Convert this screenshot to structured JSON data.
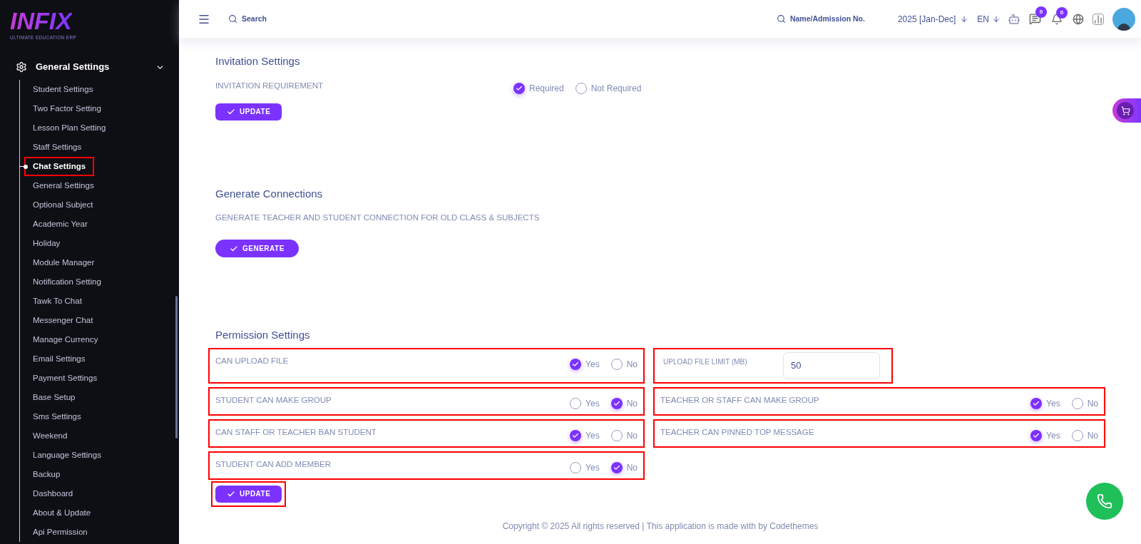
{
  "brand": {
    "logo": "INFIX",
    "tagline": "ULTIMATE EDUCATION ERP"
  },
  "sidebar": {
    "group": {
      "label": "General Settings",
      "expanded": true,
      "items": [
        {
          "label": "Student Settings",
          "selected": false,
          "highlighted": false
        },
        {
          "label": "Two Factor Setting",
          "selected": false,
          "highlighted": false
        },
        {
          "label": "Lesson Plan Setting",
          "selected": false,
          "highlighted": false
        },
        {
          "label": "Staff Settings",
          "selected": false,
          "highlighted": false
        },
        {
          "label": "Chat Settings",
          "selected": true,
          "highlighted": true
        },
        {
          "label": "General Settings",
          "selected": false,
          "highlighted": false
        },
        {
          "label": "Optional Subject",
          "selected": false,
          "highlighted": false
        },
        {
          "label": "Academic Year",
          "selected": false,
          "highlighted": false
        },
        {
          "label": "Holiday",
          "selected": false,
          "highlighted": false
        },
        {
          "label": "Module Manager",
          "selected": false,
          "highlighted": false
        },
        {
          "label": "Notification Setting",
          "selected": false,
          "highlighted": false
        },
        {
          "label": "Tawk To Chat",
          "selected": false,
          "highlighted": false
        },
        {
          "label": "Messenger Chat",
          "selected": false,
          "highlighted": false
        },
        {
          "label": "Manage Currency",
          "selected": false,
          "highlighted": false
        },
        {
          "label": "Email Settings",
          "selected": false,
          "highlighted": false
        },
        {
          "label": "Payment Settings",
          "selected": false,
          "highlighted": false
        },
        {
          "label": "Base Setup",
          "selected": false,
          "highlighted": false
        },
        {
          "label": "Sms Settings",
          "selected": false,
          "highlighted": false
        },
        {
          "label": "Weekend",
          "selected": false,
          "highlighted": false
        },
        {
          "label": "Language Settings",
          "selected": false,
          "highlighted": false
        },
        {
          "label": "Backup",
          "selected": false,
          "highlighted": false
        },
        {
          "label": "Dashboard",
          "selected": false,
          "highlighted": false
        },
        {
          "label": "About & Update",
          "selected": false,
          "highlighted": false
        },
        {
          "label": "Api Permission",
          "selected": false,
          "highlighted": false
        }
      ]
    }
  },
  "header": {
    "search_placeholder": "Search",
    "student_search_placeholder": "Name/Admission No.",
    "year": "2025 [Jan-Dec]",
    "language": "EN",
    "messages_badge": "0",
    "notifications_badge": "0"
  },
  "invitation": {
    "title": "Invitation Settings",
    "label": "INVITATION REQUIREMENT",
    "options": [
      {
        "label": "Required",
        "selected": true
      },
      {
        "label": "Not Required",
        "selected": false
      }
    ],
    "button": "UPDATE"
  },
  "connections": {
    "title": "Generate Connections",
    "description": "GENERATE TEACHER AND STUDENT CONNECTION FOR OLD CLASS & SUBJECTS",
    "button": "GENERATE"
  },
  "permissions": {
    "title": "Permission Settings",
    "settings": [
      {
        "kind": "radio",
        "label": "CAN UPLOAD FILE",
        "highlighted": true,
        "options": [
          {
            "label": "Yes",
            "selected": true
          },
          {
            "label": "No",
            "selected": false
          }
        ]
      },
      {
        "kind": "number",
        "label": "UPLOAD FILE LIMIT (MB)",
        "value": "50",
        "highlighted": true
      },
      {
        "kind": "radio",
        "label": "STUDENT CAN MAKE GROUP",
        "highlighted": true,
        "options": [
          {
            "label": "Yes",
            "selected": false
          },
          {
            "label": "No",
            "selected": true
          }
        ]
      },
      {
        "kind": "radio",
        "label": "TEACHER OR STAFF CAN MAKE GROUP",
        "highlighted": true,
        "options": [
          {
            "label": "Yes",
            "selected": true
          },
          {
            "label": "No",
            "selected": false
          }
        ]
      },
      {
        "kind": "radio",
        "label": "CAN STAFF OR TEACHER BAN STUDENT",
        "highlighted": true,
        "options": [
          {
            "label": "Yes",
            "selected": true
          },
          {
            "label": "No",
            "selected": false
          }
        ]
      },
      {
        "kind": "radio",
        "label": "TEACHER CAN PINNED TOP MESSAGE",
        "highlighted": true,
        "options": [
          {
            "label": "Yes",
            "selected": true
          },
          {
            "label": "No",
            "selected": false
          }
        ]
      },
      {
        "kind": "radio",
        "label": "STUDENT CAN ADD MEMBER",
        "highlighted": true,
        "options": [
          {
            "label": "Yes",
            "selected": false
          },
          {
            "label": "No",
            "selected": true
          }
        ]
      }
    ],
    "button": {
      "label": "UPDATE",
      "highlighted": true
    }
  },
  "footer": "Copyright © 2025 All rights reserved | This application is made with by Codethemes"
}
